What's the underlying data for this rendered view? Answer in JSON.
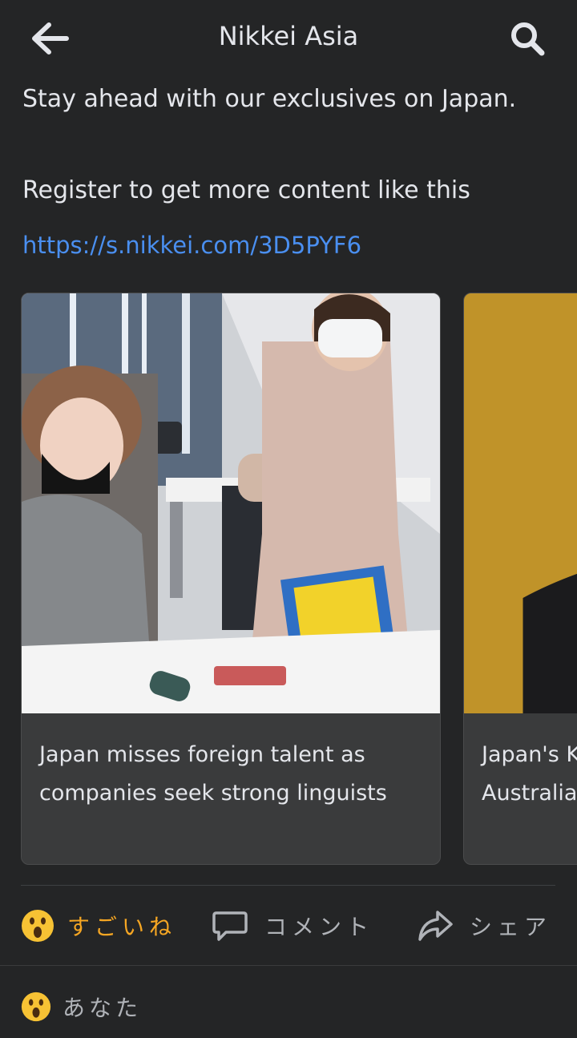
{
  "header": {
    "title": "Nikkei Asia"
  },
  "post": {
    "line1": "Stay ahead with our exclusives on Japan.",
    "line2": "Register to get more content like this",
    "link": "https://s.nikkei.com/3D5PYF6"
  },
  "carousel": {
    "cards": [
      {
        "caption": "Japan misses foreign talent as companies seek strong linguists"
      },
      {
        "caption_line1": "Japan's K",
        "caption_line2": "Australia"
      }
    ]
  },
  "actions": {
    "like_label": "すごいね",
    "comment_label": "コメント",
    "share_label": "シェア"
  },
  "reactions": {
    "label": "あなた"
  },
  "colors": {
    "background": "#242526",
    "link": "#4a8ff0",
    "like_active": "#f5a623"
  }
}
